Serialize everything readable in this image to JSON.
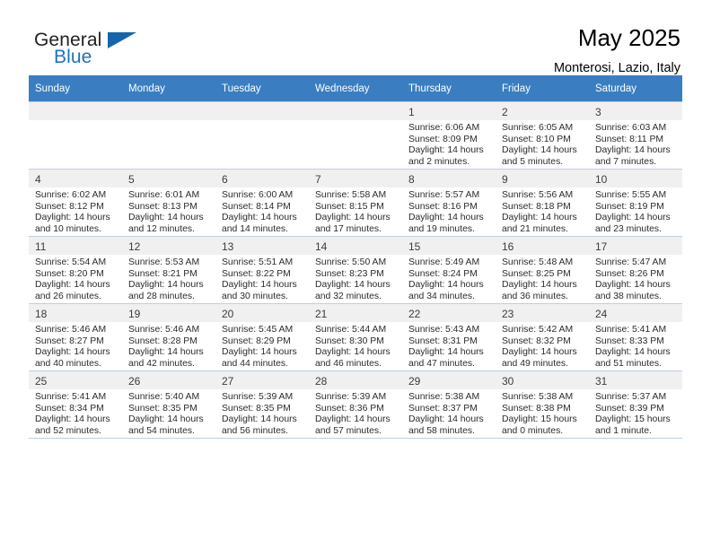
{
  "brand": {
    "word_one": "General",
    "word_two": "Blue",
    "triangle_icon": "triangle-icon"
  },
  "header": {
    "title": "May 2025",
    "location": "Monterosi, Lazio, Italy"
  },
  "colors": {
    "header_row": "#3a7ec1",
    "brand_blue": "#1b72bd",
    "daynum_band": "#f0f0f0",
    "grid_line": "#bfcfe0"
  },
  "weekdays": [
    "Sunday",
    "Monday",
    "Tuesday",
    "Wednesday",
    "Thursday",
    "Friday",
    "Saturday"
  ],
  "labels": {
    "sunrise_prefix": "Sunrise:",
    "sunset_prefix": "Sunset:",
    "daylight_prefix": "Daylight:"
  },
  "weeks": [
    [
      {
        "empty": true,
        "day": "",
        "sunrise": "",
        "sunset": "",
        "daylight_line1": "",
        "daylight_line2": ""
      },
      {
        "empty": true,
        "day": "",
        "sunrise": "",
        "sunset": "",
        "daylight_line1": "",
        "daylight_line2": ""
      },
      {
        "empty": true,
        "day": "",
        "sunrise": "",
        "sunset": "",
        "daylight_line1": "",
        "daylight_line2": ""
      },
      {
        "empty": true,
        "day": "",
        "sunrise": "",
        "sunset": "",
        "daylight_line1": "",
        "daylight_line2": ""
      },
      {
        "empty": false,
        "day": "1",
        "sunrise": "Sunrise: 6:06 AM",
        "sunset": "Sunset: 8:09 PM",
        "daylight_line1": "Daylight: 14 hours",
        "daylight_line2": "and 2 minutes."
      },
      {
        "empty": false,
        "day": "2",
        "sunrise": "Sunrise: 6:05 AM",
        "sunset": "Sunset: 8:10 PM",
        "daylight_line1": "Daylight: 14 hours",
        "daylight_line2": "and 5 minutes."
      },
      {
        "empty": false,
        "day": "3",
        "sunrise": "Sunrise: 6:03 AM",
        "sunset": "Sunset: 8:11 PM",
        "daylight_line1": "Daylight: 14 hours",
        "daylight_line2": "and 7 minutes."
      }
    ],
    [
      {
        "empty": false,
        "day": "4",
        "sunrise": "Sunrise: 6:02 AM",
        "sunset": "Sunset: 8:12 PM",
        "daylight_line1": "Daylight: 14 hours",
        "daylight_line2": "and 10 minutes."
      },
      {
        "empty": false,
        "day": "5",
        "sunrise": "Sunrise: 6:01 AM",
        "sunset": "Sunset: 8:13 PM",
        "daylight_line1": "Daylight: 14 hours",
        "daylight_line2": "and 12 minutes."
      },
      {
        "empty": false,
        "day": "6",
        "sunrise": "Sunrise: 6:00 AM",
        "sunset": "Sunset: 8:14 PM",
        "daylight_line1": "Daylight: 14 hours",
        "daylight_line2": "and 14 minutes."
      },
      {
        "empty": false,
        "day": "7",
        "sunrise": "Sunrise: 5:58 AM",
        "sunset": "Sunset: 8:15 PM",
        "daylight_line1": "Daylight: 14 hours",
        "daylight_line2": "and 17 minutes."
      },
      {
        "empty": false,
        "day": "8",
        "sunrise": "Sunrise: 5:57 AM",
        "sunset": "Sunset: 8:16 PM",
        "daylight_line1": "Daylight: 14 hours",
        "daylight_line2": "and 19 minutes."
      },
      {
        "empty": false,
        "day": "9",
        "sunrise": "Sunrise: 5:56 AM",
        "sunset": "Sunset: 8:18 PM",
        "daylight_line1": "Daylight: 14 hours",
        "daylight_line2": "and 21 minutes."
      },
      {
        "empty": false,
        "day": "10",
        "sunrise": "Sunrise: 5:55 AM",
        "sunset": "Sunset: 8:19 PM",
        "daylight_line1": "Daylight: 14 hours",
        "daylight_line2": "and 23 minutes."
      }
    ],
    [
      {
        "empty": false,
        "day": "11",
        "sunrise": "Sunrise: 5:54 AM",
        "sunset": "Sunset: 8:20 PM",
        "daylight_line1": "Daylight: 14 hours",
        "daylight_line2": "and 26 minutes."
      },
      {
        "empty": false,
        "day": "12",
        "sunrise": "Sunrise: 5:53 AM",
        "sunset": "Sunset: 8:21 PM",
        "daylight_line1": "Daylight: 14 hours",
        "daylight_line2": "and 28 minutes."
      },
      {
        "empty": false,
        "day": "13",
        "sunrise": "Sunrise: 5:51 AM",
        "sunset": "Sunset: 8:22 PM",
        "daylight_line1": "Daylight: 14 hours",
        "daylight_line2": "and 30 minutes."
      },
      {
        "empty": false,
        "day": "14",
        "sunrise": "Sunrise: 5:50 AM",
        "sunset": "Sunset: 8:23 PM",
        "daylight_line1": "Daylight: 14 hours",
        "daylight_line2": "and 32 minutes."
      },
      {
        "empty": false,
        "day": "15",
        "sunrise": "Sunrise: 5:49 AM",
        "sunset": "Sunset: 8:24 PM",
        "daylight_line1": "Daylight: 14 hours",
        "daylight_line2": "and 34 minutes."
      },
      {
        "empty": false,
        "day": "16",
        "sunrise": "Sunrise: 5:48 AM",
        "sunset": "Sunset: 8:25 PM",
        "daylight_line1": "Daylight: 14 hours",
        "daylight_line2": "and 36 minutes."
      },
      {
        "empty": false,
        "day": "17",
        "sunrise": "Sunrise: 5:47 AM",
        "sunset": "Sunset: 8:26 PM",
        "daylight_line1": "Daylight: 14 hours",
        "daylight_line2": "and 38 minutes."
      }
    ],
    [
      {
        "empty": false,
        "day": "18",
        "sunrise": "Sunrise: 5:46 AM",
        "sunset": "Sunset: 8:27 PM",
        "daylight_line1": "Daylight: 14 hours",
        "daylight_line2": "and 40 minutes."
      },
      {
        "empty": false,
        "day": "19",
        "sunrise": "Sunrise: 5:46 AM",
        "sunset": "Sunset: 8:28 PM",
        "daylight_line1": "Daylight: 14 hours",
        "daylight_line2": "and 42 minutes."
      },
      {
        "empty": false,
        "day": "20",
        "sunrise": "Sunrise: 5:45 AM",
        "sunset": "Sunset: 8:29 PM",
        "daylight_line1": "Daylight: 14 hours",
        "daylight_line2": "and 44 minutes."
      },
      {
        "empty": false,
        "day": "21",
        "sunrise": "Sunrise: 5:44 AM",
        "sunset": "Sunset: 8:30 PM",
        "daylight_line1": "Daylight: 14 hours",
        "daylight_line2": "and 46 minutes."
      },
      {
        "empty": false,
        "day": "22",
        "sunrise": "Sunrise: 5:43 AM",
        "sunset": "Sunset: 8:31 PM",
        "daylight_line1": "Daylight: 14 hours",
        "daylight_line2": "and 47 minutes."
      },
      {
        "empty": false,
        "day": "23",
        "sunrise": "Sunrise: 5:42 AM",
        "sunset": "Sunset: 8:32 PM",
        "daylight_line1": "Daylight: 14 hours",
        "daylight_line2": "and 49 minutes."
      },
      {
        "empty": false,
        "day": "24",
        "sunrise": "Sunrise: 5:41 AM",
        "sunset": "Sunset: 8:33 PM",
        "daylight_line1": "Daylight: 14 hours",
        "daylight_line2": "and 51 minutes."
      }
    ],
    [
      {
        "empty": false,
        "day": "25",
        "sunrise": "Sunrise: 5:41 AM",
        "sunset": "Sunset: 8:34 PM",
        "daylight_line1": "Daylight: 14 hours",
        "daylight_line2": "and 52 minutes."
      },
      {
        "empty": false,
        "day": "26",
        "sunrise": "Sunrise: 5:40 AM",
        "sunset": "Sunset: 8:35 PM",
        "daylight_line1": "Daylight: 14 hours",
        "daylight_line2": "and 54 minutes."
      },
      {
        "empty": false,
        "day": "27",
        "sunrise": "Sunrise: 5:39 AM",
        "sunset": "Sunset: 8:35 PM",
        "daylight_line1": "Daylight: 14 hours",
        "daylight_line2": "and 56 minutes."
      },
      {
        "empty": false,
        "day": "28",
        "sunrise": "Sunrise: 5:39 AM",
        "sunset": "Sunset: 8:36 PM",
        "daylight_line1": "Daylight: 14 hours",
        "daylight_line2": "and 57 minutes."
      },
      {
        "empty": false,
        "day": "29",
        "sunrise": "Sunrise: 5:38 AM",
        "sunset": "Sunset: 8:37 PM",
        "daylight_line1": "Daylight: 14 hours",
        "daylight_line2": "and 58 minutes."
      },
      {
        "empty": false,
        "day": "30",
        "sunrise": "Sunrise: 5:38 AM",
        "sunset": "Sunset: 8:38 PM",
        "daylight_line1": "Daylight: 15 hours",
        "daylight_line2": "and 0 minutes."
      },
      {
        "empty": false,
        "day": "31",
        "sunrise": "Sunrise: 5:37 AM",
        "sunset": "Sunset: 8:39 PM",
        "daylight_line1": "Daylight: 15 hours",
        "daylight_line2": "and 1 minute."
      }
    ]
  ]
}
